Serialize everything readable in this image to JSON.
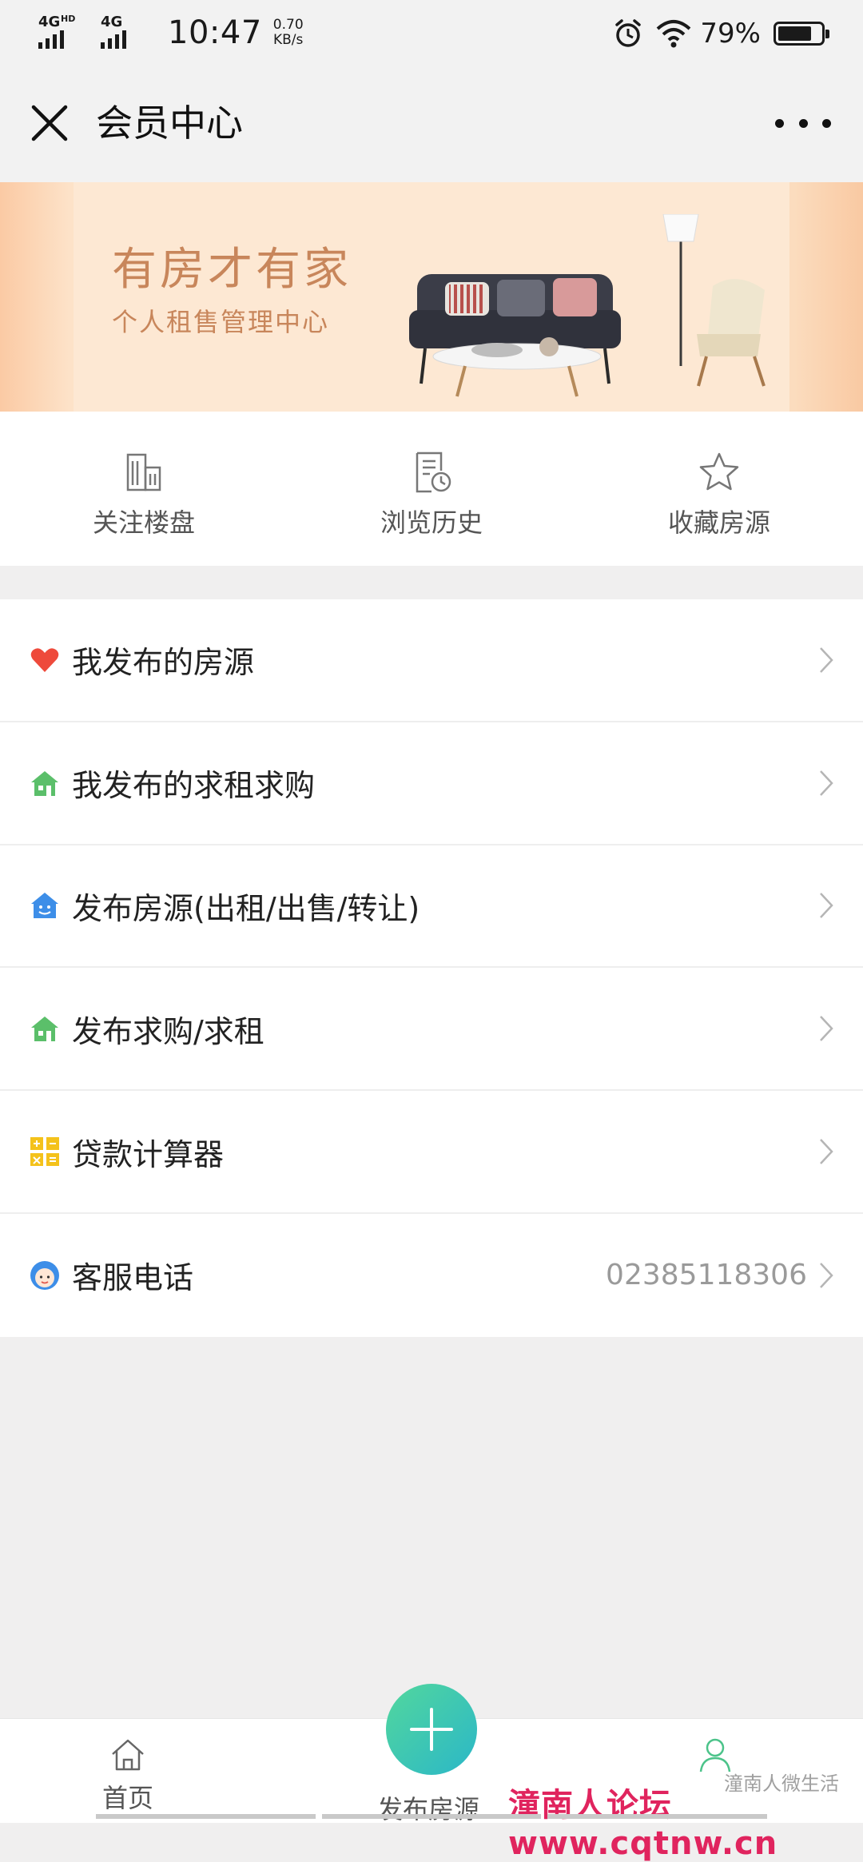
{
  "status_bar": {
    "network1": "4G",
    "network1_sup": "HD",
    "network2": "4G",
    "time": "10:47",
    "speed_value": "0.70",
    "speed_unit": "KB/s",
    "battery_percent": "79%",
    "battery_level": 0.79
  },
  "title_bar": {
    "title": "会员中心",
    "close_icon": "close-icon",
    "more_icon": "more-icon"
  },
  "banner": {
    "title": "有房才有家",
    "subtitle": "个人租售管理中心"
  },
  "quick_nav": [
    {
      "label": "关注楼盘",
      "icon": "building-icon"
    },
    {
      "label": "浏览历史",
      "icon": "history-icon"
    },
    {
      "label": "收藏房源",
      "icon": "star-icon"
    }
  ],
  "menu": [
    {
      "label": "我发布的房源",
      "icon": "heart-icon",
      "value": ""
    },
    {
      "label": "我发布的求租求购",
      "icon": "house-icon",
      "value": ""
    },
    {
      "label": "发布房源(出租/出售/转让)",
      "icon": "smile-house-icon",
      "value": ""
    },
    {
      "label": "发布求购/求租",
      "icon": "house-icon",
      "value": ""
    },
    {
      "label": "贷款计算器",
      "icon": "calculator-icon",
      "value": ""
    },
    {
      "label": "客服电话",
      "icon": "service-icon",
      "value": "02385118306"
    }
  ],
  "tab_bar": {
    "home": "首页",
    "post": "发布房源",
    "me_icon": "user-icon"
  },
  "watermarks": {
    "wechat": "潼南人微生活",
    "forum": "潼南人论坛www.cqtnw.cn"
  },
  "colors": {
    "accent_green": "#4cc38a",
    "banner_text": "#c8865b",
    "heart": "#ee4a3b",
    "house_green": "#5bbf6a",
    "smile_blue": "#3d8ee8",
    "calc_yellow": "#f4c21b"
  }
}
